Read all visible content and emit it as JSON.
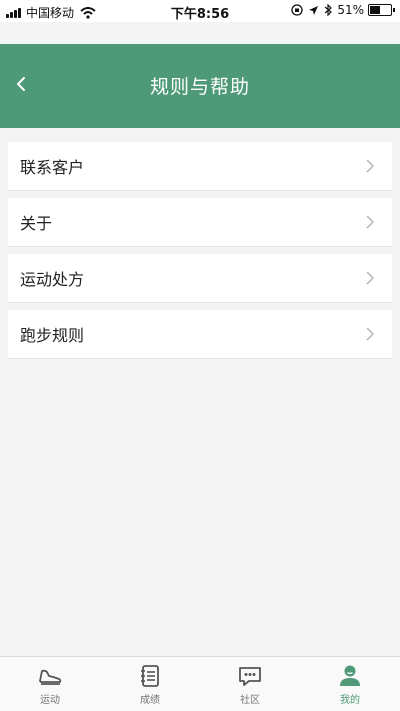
{
  "status_bar": {
    "carrier": "中国移动",
    "time": "下午8:56",
    "battery_percent": "51%",
    "battery_level": 0.51
  },
  "header": {
    "title": "规则与帮助",
    "back_icon": "chevron-left-icon",
    "color": "#4e9a78"
  },
  "menu": {
    "items": [
      {
        "label": "联系客户"
      },
      {
        "label": "关于"
      },
      {
        "label": "运动处方"
      },
      {
        "label": "跑步规则"
      }
    ]
  },
  "tabs": [
    {
      "label": "运动",
      "icon": "sneaker-icon",
      "active": false
    },
    {
      "label": "成绩",
      "icon": "notebook-icon",
      "active": false
    },
    {
      "label": "社区",
      "icon": "chat-bubble-icon",
      "active": false
    },
    {
      "label": "我的",
      "icon": "user-icon",
      "active": true
    }
  ],
  "colors": {
    "accent": "#4e9a78",
    "background": "#f4f4f4",
    "inactive_tab": "#777777"
  }
}
